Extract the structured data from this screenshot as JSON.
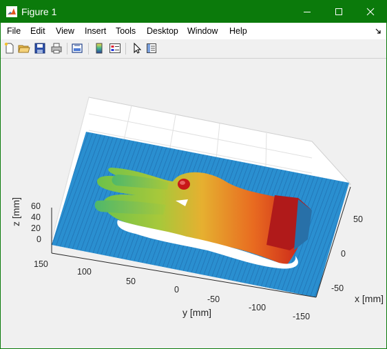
{
  "window": {
    "title": "Figure 1",
    "app_icon": "matlab-icon",
    "buttons": [
      "minimize-icon",
      "maximize-icon",
      "close-icon"
    ],
    "accent": "#0b7a0b"
  },
  "menubar": {
    "items": [
      "File",
      "Edit",
      "View",
      "Insert",
      "Tools",
      "Desktop",
      "Window",
      "Help"
    ],
    "overflow_icon": "dock-arrow-icon"
  },
  "toolbar": {
    "buttons": [
      "new-figure-icon",
      "open-file-icon",
      "save-icon",
      "print-icon",
      "link-plot-icon",
      "insert-colorbar-icon",
      "insert-legend-icon",
      "edit-plot-icon",
      "property-inspector-icon"
    ]
  },
  "plot": {
    "z_axis": {
      "label": "z [mm]",
      "ticks": [
        "60",
        "40",
        "20",
        "0"
      ]
    },
    "y_axis": {
      "label": "y [mm]",
      "ticks": [
        "150",
        "100",
        "50",
        "0",
        "-50",
        "-100",
        "-150"
      ]
    },
    "x_axis": {
      "label": "x [mm]",
      "ticks": [
        "50",
        "0",
        "-50"
      ]
    },
    "colormap": [
      "#1f77c8",
      "#2aa0b0",
      "#7ac64a",
      "#c8c830",
      "#e89a20",
      "#e03020",
      "#b01010"
    ]
  }
}
